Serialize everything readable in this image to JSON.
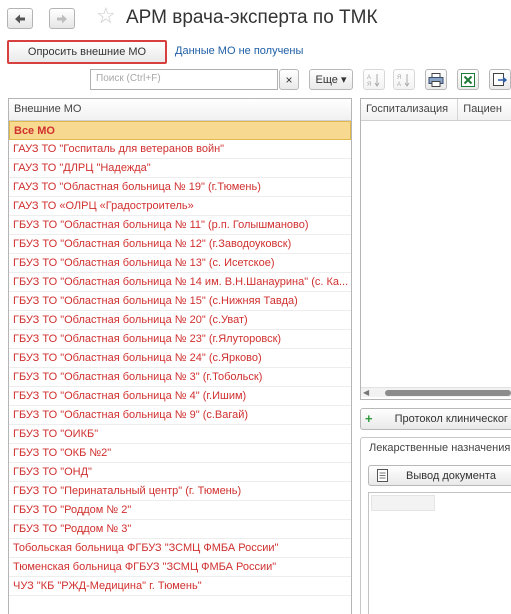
{
  "window": {
    "title": "АРМ врача-эксперта по ТМК"
  },
  "toolbar": {
    "query_button": "Опросить внешние МО",
    "status_link": "Данные МО не получены"
  },
  "search": {
    "placeholder": "Поиск (Ctrl+F)",
    "clear_label": "×",
    "more_label": "Еще ▾"
  },
  "icons": {
    "back": "arrow-left-icon",
    "forward": "arrow-right-icon",
    "favorite": "star-icon",
    "sort_asc": "sort-ascending-icon",
    "sort_desc": "sort-descending-icon",
    "print": "printer-icon",
    "excel": "excel-icon",
    "export": "export-icon",
    "add": "plus-icon",
    "document": "document-icon"
  },
  "colors": {
    "accent_red": "#d0302f",
    "selection": "#f7d98f",
    "link": "#1f5fa6",
    "highlight_border": "#d84040"
  },
  "mo_list": {
    "header": "Внешние МО",
    "items": [
      "Все МО",
      "ГАУЗ ТО \"Госпиталь для ветеранов войн\"",
      "ГАУЗ ТО \"ДЛРЦ \"Надежда\"",
      "ГАУЗ ТО \"Областная больница № 19\" (г.Тюмень)",
      "ГАУЗ ТО «ОЛРЦ «Градостроитель»",
      "ГБУЗ ТО \"Областная больница № 11\" (р.п. Голышманово)",
      "ГБУЗ ТО \"Областная больница № 12\" (г.Заводоуковск)",
      "ГБУЗ ТО \"Областная больница № 13\" (с. Исетское)",
      "ГБУЗ ТО \"Областная больница № 14 им. В.Н.Шанаурина\" (с. Ка...",
      "ГБУЗ ТО \"Областная больница № 15\" (с.Нижняя Тавда)",
      "ГБУЗ ТО \"Областная больница № 20\" (с.Уват)",
      "ГБУЗ ТО \"Областная больница № 23\" (г.Ялуторовск)",
      "ГБУЗ ТО \"Областная больница № 24\" (с.Ярково)",
      "ГБУЗ ТО \"Областная больница № 3\" (г.Тобольск)",
      "ГБУЗ ТО \"Областная больница № 4\" (г.Ишим)",
      "ГБУЗ ТО \"Областная больница № 9\" (с.Вагай)",
      "ГБУЗ ТО \"ОИКБ\"",
      "ГБУЗ ТО \"ОКБ №2\"",
      "ГБУЗ ТО \"ОНД\"",
      "ГБУЗ ТО \"Перинатальный центр\" (г. Тюмень)",
      "ГБУЗ ТО \"Роддом № 2\"",
      "ГБУЗ ТО \"Роддом № 3\"",
      "Тобольская больница ФГБУЗ \"ЗСМЦ ФМБА России\"",
      "Тюменская больница ФГБУЗ \"ЗСМЦ ФМБА России\"",
      "ЧУЗ \"КБ \"РЖД-Медицина\" г. Тюмень\""
    ]
  },
  "right_grid": {
    "columns": [
      "Госпитализация",
      "Пациен"
    ]
  },
  "protocol": {
    "button_label": "Протокол клиническог"
  },
  "meds": {
    "title": "Лекарственные назначения",
    "output_button": "Вывод документа"
  }
}
